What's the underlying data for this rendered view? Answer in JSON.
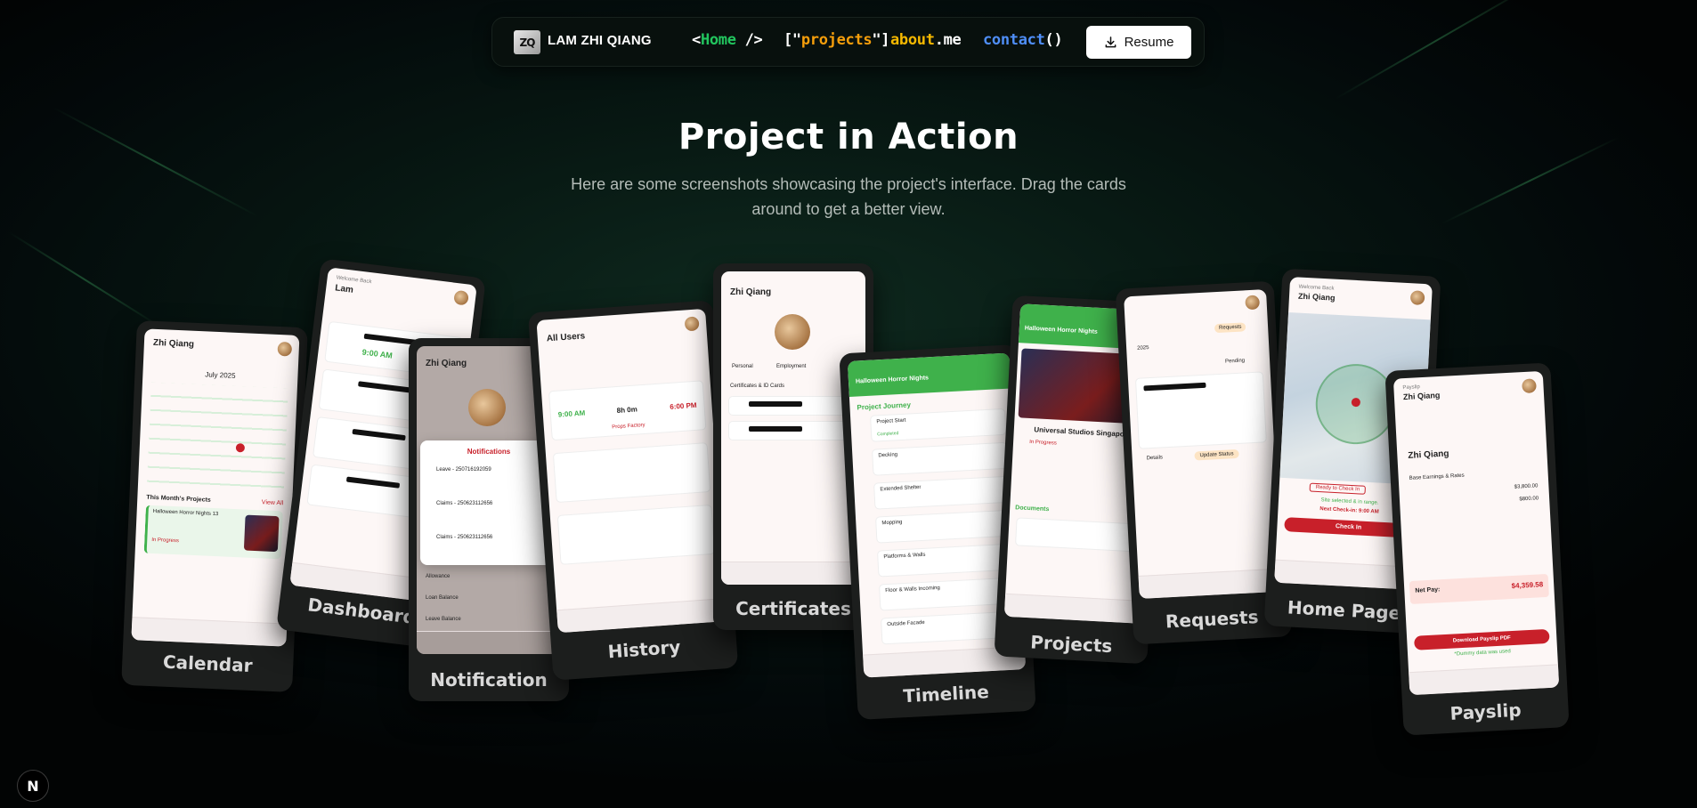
{
  "nav": {
    "logo_mark": "ZQ",
    "brand": "LAM ZHI QIANG",
    "links": [
      {
        "pre": "<",
        "word": "Home",
        "post": " />"
      },
      {
        "pre": "[\"",
        "word": "projects",
        "post": "\"]"
      },
      {
        "pre": "",
        "word": "about",
        "post": ".me"
      },
      {
        "pre": "",
        "word": "contact",
        "post": "()"
      }
    ],
    "resume_label": "Resume"
  },
  "hero": {
    "title": "Project in Action",
    "subtitle": "Here are some screenshots showcasing the project's interface. Drag the cards around to get a better view."
  },
  "cards": {
    "calendar": {
      "label": "Calendar",
      "month": "July 2025",
      "header": "Zhi Qiang",
      "section": "This Month's Projects",
      "view_all": "View All",
      "project": "Halloween Horror Nights 13",
      "status": "In Progress"
    },
    "dashboard": {
      "label": "Dashboard",
      "greeting": "Welcome Back",
      "name": "Lam",
      "time": "9:00 AM"
    },
    "notification": {
      "label": "Notification",
      "header": "Zhi Qiang",
      "modal_title": "Notifications",
      "item1": "Leave - 250716192059",
      "item2": "Claims - 250623112656",
      "item3": "Claims - 250623112656",
      "row1": "Allowance",
      "row2": "Loan Balance",
      "row3": "Leave Balance"
    },
    "history": {
      "label": "History",
      "title": "All Users",
      "time_in": "9:00 AM",
      "duration": "8h 0m",
      "time_out": "6:00 PM",
      "site": "Props Factory"
    },
    "certificates": {
      "label": "Certificates",
      "header": "Zhi Qiang",
      "section": "Certificates & ID Cards",
      "tab1": "Personal",
      "tab2": "Employment"
    },
    "timeline": {
      "label": "Timeline",
      "banner": "Halloween Horror Nights",
      "section": "Project Journey",
      "steps": [
        "Project Start",
        "Decking",
        "Extended Shelter",
        "Mopping",
        "Platforms & Walls",
        "Floor & Walls Incoming",
        "Outside Facade"
      ],
      "state": "Completed"
    },
    "projects": {
      "label": "Projects",
      "banner": "Halloween Horror Nights",
      "venue": "Universal Studios Singapore",
      "status": "In Progress",
      "section": "Documents"
    },
    "requests": {
      "label": "Requests",
      "tab": "Requests",
      "year": "2025",
      "status": "Pending",
      "details": "Details",
      "update": "Update Status"
    },
    "home": {
      "label": "Home Page",
      "greeting": "Welcome Back",
      "name": "Zhi Qiang",
      "ready": "Ready to Check In",
      "site_msg": "Site selected & in range.",
      "next": "Next Check-in: 9:00 AM",
      "check_in": "Check In"
    },
    "payslip": {
      "label": "Payslip",
      "title": "Payslip",
      "name": "Zhi Qiang",
      "section": "Base Earnings & Rates",
      "base_pay": "$3,800.00",
      "allowance": "$800.00",
      "net_label": "Net Pay:",
      "net_pay": "$4,359.58",
      "download": "Download Payslip PDF",
      "note": "*Dummy data was used"
    }
  },
  "next_badge": "N",
  "colors": {
    "green": "#22c55e",
    "orange": "#f59e0b",
    "blue": "#3b82f6",
    "brand_red": "#c8202a",
    "app_green": "#3fb14b"
  }
}
